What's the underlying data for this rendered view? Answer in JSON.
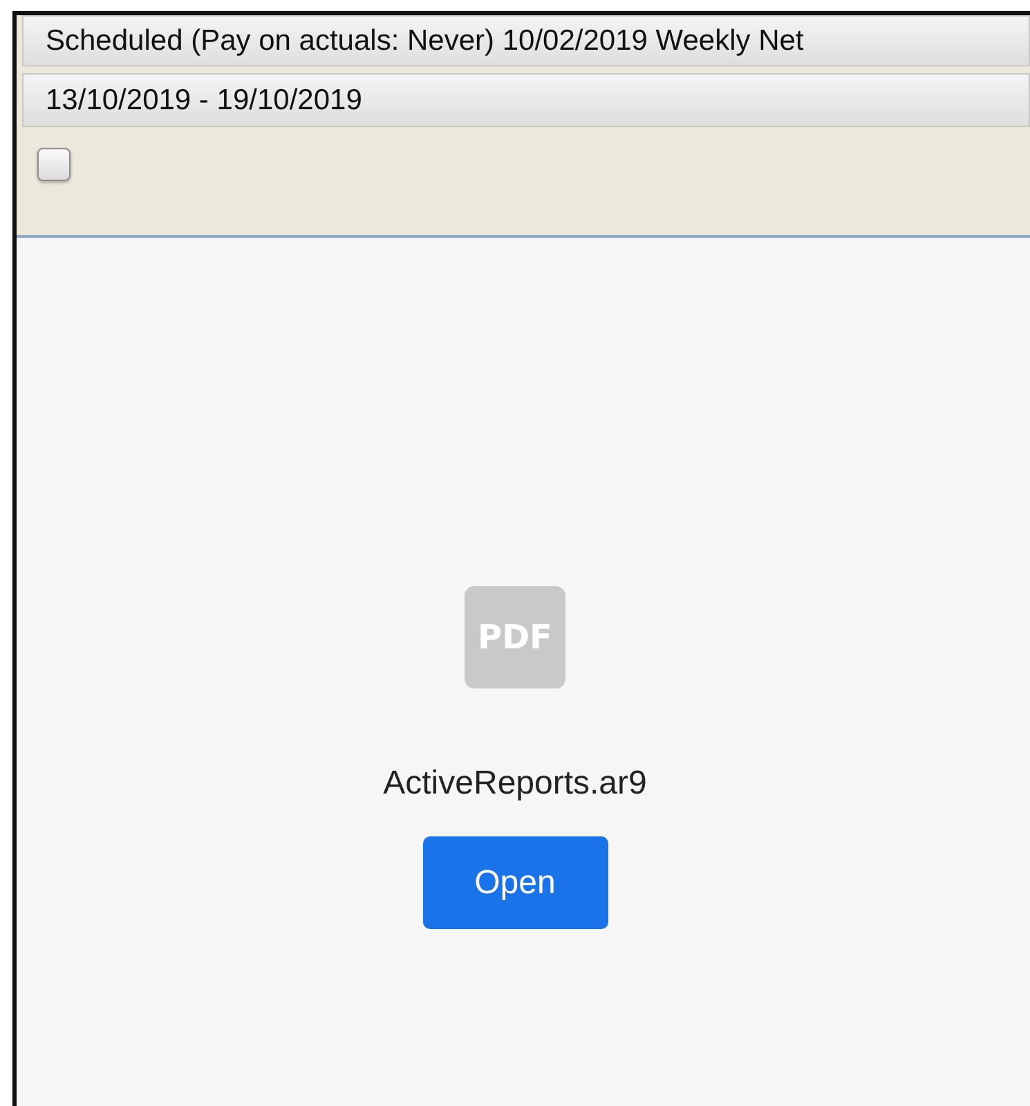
{
  "schedule_header": {
    "text": "Scheduled (Pay on actuals: Never) 10/02/2019 Weekly Net"
  },
  "date_range": {
    "text": "13/10/2019 - 19/10/2019"
  },
  "checkbox": {
    "checked": false
  },
  "attachment": {
    "icon_label": "PDF",
    "file_name": "ActiveReports.ar9",
    "button": "Open"
  }
}
